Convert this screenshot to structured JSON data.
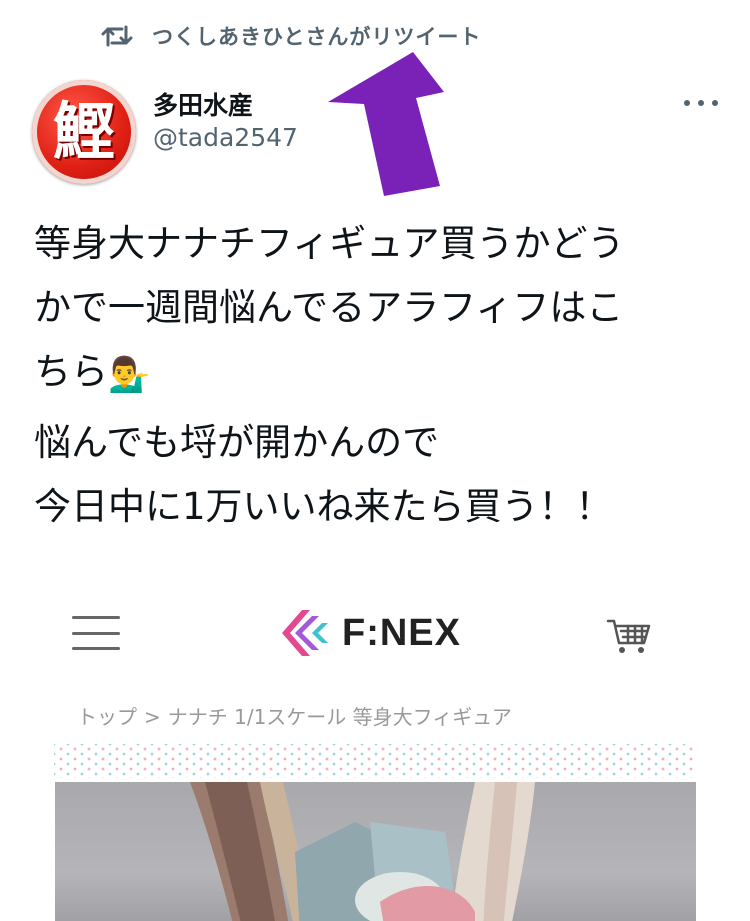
{
  "retweet": {
    "icon": "retweet-icon",
    "text": "つくしあきひとさんがリツイート"
  },
  "author": {
    "avatar_glyph": "鰹",
    "display_name": "多田水産",
    "handle": "@tada2547"
  },
  "more_icon": "more-options-icon",
  "tweet": {
    "paragraph1_lines": [
      "等身大ナナチフィギュア買うかどう",
      "かで一週間悩んでるアラフィフはこ",
      "ちら"
    ],
    "paragraph1_emoji": "💁‍♂️",
    "paragraph2_lines": [
      "悩んでも埒が開かんので",
      "今日中に1万いいね来たら買う！！"
    ]
  },
  "embedded_page": {
    "menu_icon": "hamburger-menu-icon",
    "brand_name": "F:NEX",
    "cart_icon": "cart-icon",
    "breadcrumb": {
      "home": "トップ",
      "separator": ">",
      "current": "ナナチ 1/1スケール 等身大フィギュア"
    }
  },
  "colors": {
    "secondary_text": "#536471",
    "annotation_arrow": "#7a22b8",
    "avatar_red": "#e02015"
  }
}
